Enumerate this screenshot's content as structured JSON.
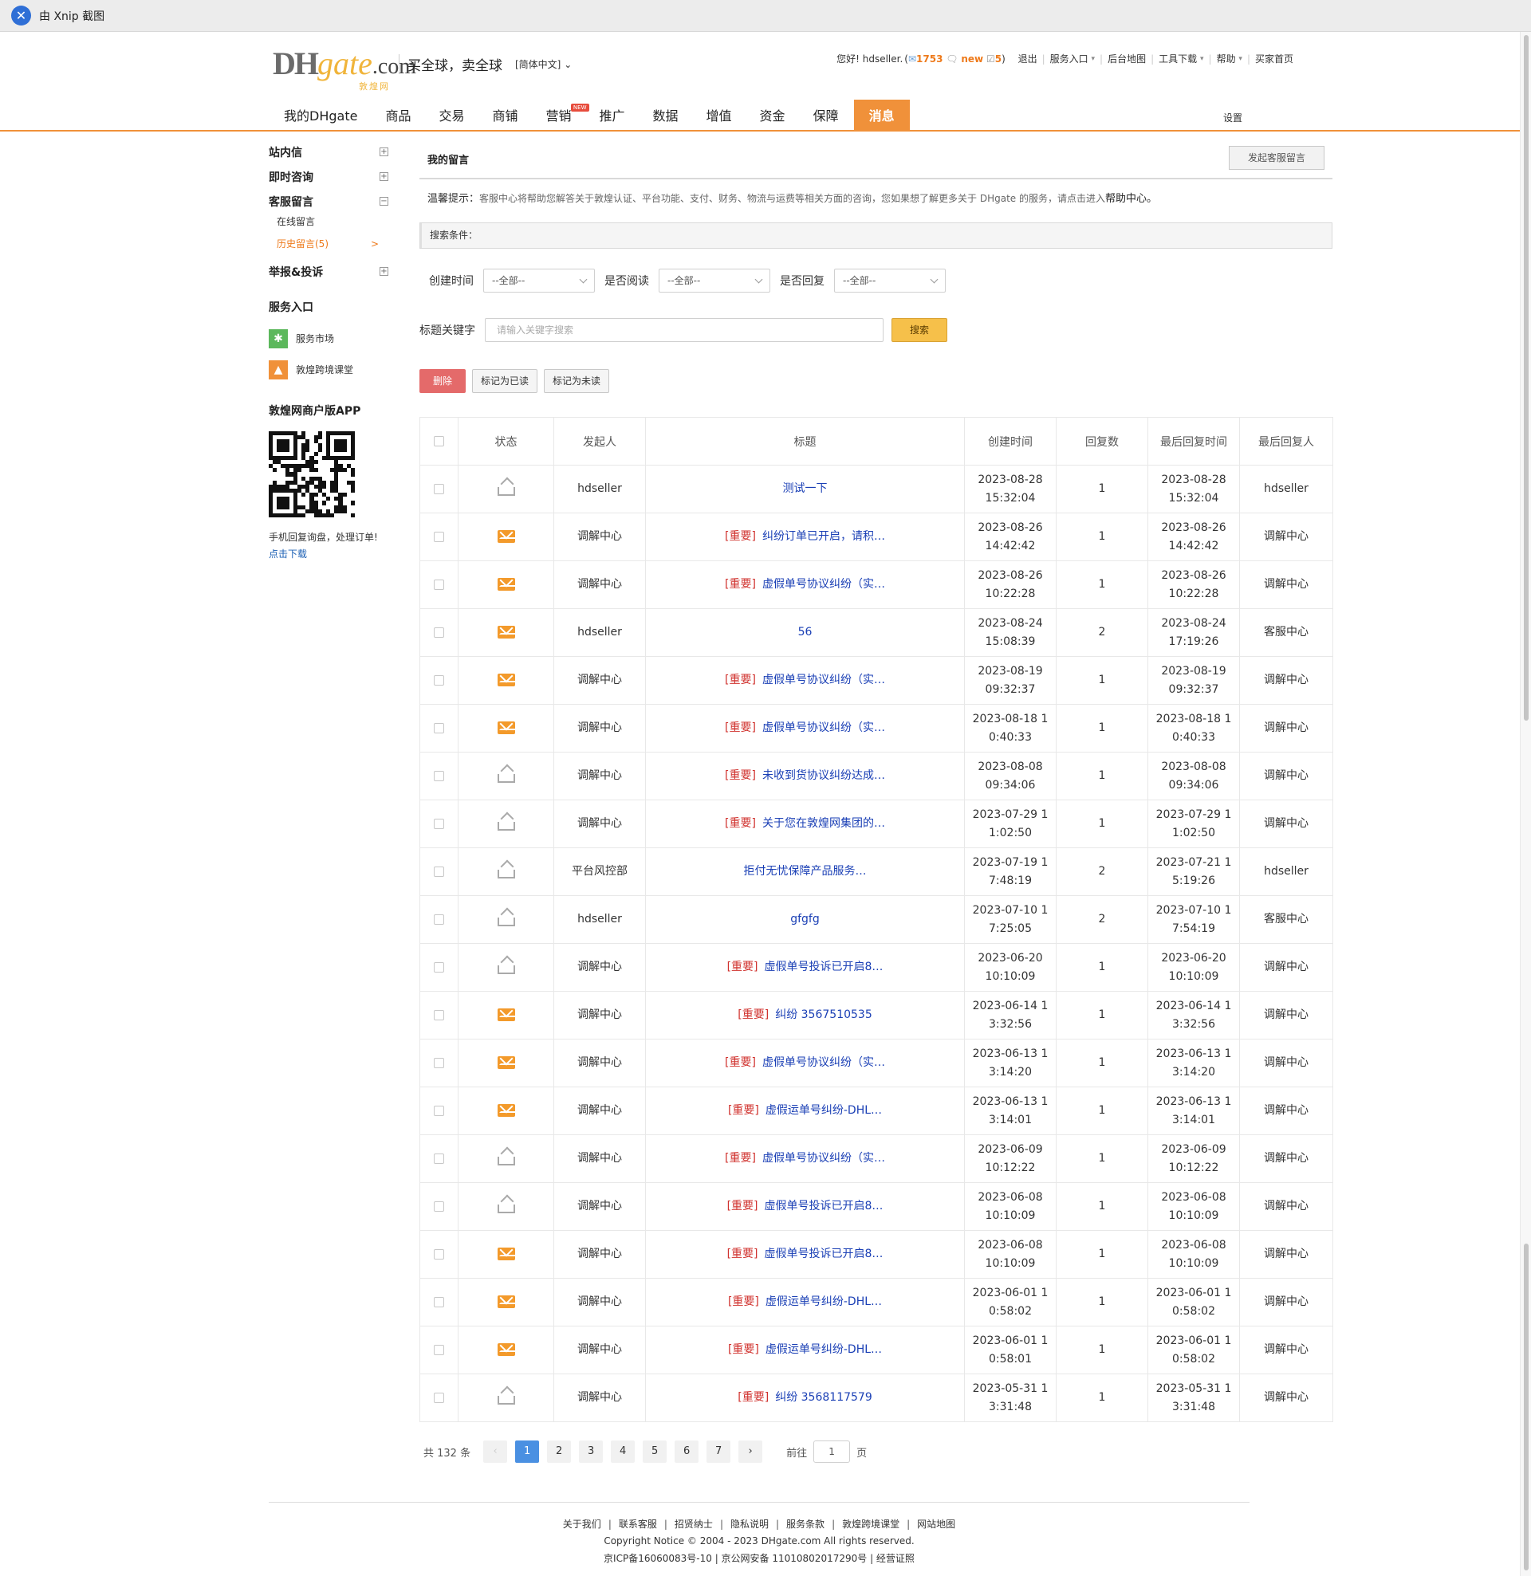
{
  "xnip": {
    "title": "由 Xnip 截图"
  },
  "header": {
    "logo_dh": "DH",
    "logo_gate": "gate",
    "logo_com": ".com",
    "logo_cn": "敦煌网",
    "slogan": "买全球，卖全球",
    "language": "[简体中文]",
    "greeting": "您好!",
    "user": "hdseller.",
    "mail_count": "1753",
    "new_label": "new",
    "msg_count": "5",
    "logout": "退出",
    "service_entry": "服务入口",
    "backend_map": "后台地图",
    "tools_download": "工具下载",
    "help": "帮助",
    "buyer_home": "买家首页"
  },
  "nav": {
    "items": [
      "我的DHgate",
      "商品",
      "交易",
      "商铺",
      "营销",
      "推广",
      "数据",
      "增值",
      "资金",
      "保障",
      "消息"
    ],
    "new_tag": "NEW",
    "settings": "设置"
  },
  "sidebar": {
    "groups": [
      "站内信",
      "即时咨询",
      "客服留言",
      "举报&投诉"
    ],
    "sub_online": "在线留言",
    "sub_history": "历史留言(5)",
    "sub_arrow": ">",
    "service_title": "服务入口",
    "service_market": "服务市场",
    "service_class": "敦煌跨境课堂",
    "app_title": "敦煌网商户版APP",
    "app_desc": "手机回复询盘，处理订单!",
    "app_download": "点击下载"
  },
  "main": {
    "title": "我的留言",
    "new_button": "发起客服留言",
    "tip_label": "温馨提示：",
    "tip_text": "客服中心将帮助您解答关于敦煌认证、平台功能、支付、财务、物流与运费等相关方面的咨询，您如果想了解更多关于 DHgate 的服务，请点击进入",
    "tip_link": "帮助中心。",
    "search_title": "搜索条件：",
    "f_created": "创建时间",
    "f_read": "是否阅读",
    "f_replied": "是否回复",
    "select_all": "--全部--",
    "kw_label": "标题关键字",
    "kw_placeholder": "请输入关键字搜索",
    "search_btn": "搜索",
    "delete_btn": "删除",
    "mark_read_btn": "标记为已读",
    "mark_unread_btn": "标记为未读"
  },
  "table": {
    "headers": [
      "状态",
      "发起人",
      "标题",
      "创建时间",
      "回复数",
      "最后回复时间",
      "最后回复人"
    ],
    "important_tag": "[重要]",
    "rows": [
      {
        "status": "read",
        "sender": "hdseller",
        "imp": false,
        "title": "测试一下",
        "created": "2023-08-28 15:32:04",
        "replies": "1",
        "last_time": "2023-08-28 15:32:04",
        "last_by": "hdseller"
      },
      {
        "status": "unread",
        "sender": "调解中心",
        "imp": true,
        "title": "纠纷订单已开启，请积…",
        "created": "2023-08-26 14:42:42",
        "replies": "1",
        "last_time": "2023-08-26 14:42:42",
        "last_by": "调解中心"
      },
      {
        "status": "unread",
        "sender": "调解中心",
        "imp": true,
        "title": "虚假单号协议纠纷（实…",
        "created": "2023-08-26 10:22:28",
        "replies": "1",
        "last_time": "2023-08-26 10:22:28",
        "last_by": "调解中心"
      },
      {
        "status": "unread",
        "sender": "hdseller",
        "imp": false,
        "title": "56",
        "created": "2023-08-24 15:08:39",
        "replies": "2",
        "last_time": "2023-08-24 17:19:26",
        "last_by": "客服中心"
      },
      {
        "status": "unread",
        "sender": "调解中心",
        "imp": true,
        "title": "虚假单号协议纠纷（实…",
        "created": "2023-08-19 09:32:37",
        "replies": "1",
        "last_time": "2023-08-19 09:32:37",
        "last_by": "调解中心"
      },
      {
        "status": "unread",
        "sender": "调解中心",
        "imp": true,
        "title": "虚假单号协议纠纷（实…",
        "created": "2023-08-18 1 0:40:33",
        "replies": "1",
        "last_time": "2023-08-18 1 0:40:33",
        "last_by": "调解中心"
      },
      {
        "status": "read",
        "sender": "调解中心",
        "imp": true,
        "title": "未收到货协议纠纷达成…",
        "created": "2023-08-08 09:34:06",
        "replies": "1",
        "last_time": "2023-08-08 09:34:06",
        "last_by": "调解中心"
      },
      {
        "status": "read",
        "sender": "调解中心",
        "imp": true,
        "title": "关于您在敦煌网集团的…",
        "created": "2023-07-29 1 1:02:50",
        "replies": "1",
        "last_time": "2023-07-29 1 1:02:50",
        "last_by": "调解中心"
      },
      {
        "status": "read",
        "sender": "平台风控部",
        "imp": false,
        "title": "拒付无忧保障产品服务…",
        "created": "2023-07-19 1 7:48:19",
        "replies": "2",
        "last_time": "2023-07-21 1 5:19:26",
        "last_by": "hdseller"
      },
      {
        "status": "read",
        "sender": "hdseller",
        "imp": false,
        "title": "gfgfg",
        "created": "2023-07-10 1 7:25:05",
        "replies": "2",
        "last_time": "2023-07-10 1 7:54:19",
        "last_by": "客服中心"
      },
      {
        "status": "read",
        "sender": "调解中心",
        "imp": true,
        "title": "虚假单号投诉已开启8…",
        "created": "2023-06-20 10:10:09",
        "replies": "1",
        "last_time": "2023-06-20 10:10:09",
        "last_by": "调解中心"
      },
      {
        "status": "unread",
        "sender": "调解中心",
        "imp": true,
        "title": "纠纷 3567510535",
        "created": "2023-06-14 1 3:32:56",
        "replies": "1",
        "last_time": "2023-06-14 1 3:32:56",
        "last_by": "调解中心"
      },
      {
        "status": "unread",
        "sender": "调解中心",
        "imp": true,
        "title": "虚假单号协议纠纷（实…",
        "created": "2023-06-13 1 3:14:20",
        "replies": "1",
        "last_time": "2023-06-13 1 3:14:20",
        "last_by": "调解中心"
      },
      {
        "status": "unread",
        "sender": "调解中心",
        "imp": true,
        "title": "虚假运单号纠纷-DHL…",
        "created": "2023-06-13 1 3:14:01",
        "replies": "1",
        "last_time": "2023-06-13 1 3:14:01",
        "last_by": "调解中心"
      },
      {
        "status": "read",
        "sender": "调解中心",
        "imp": true,
        "title": "虚假单号协议纠纷（实…",
        "created": "2023-06-09 10:12:22",
        "replies": "1",
        "last_time": "2023-06-09 10:12:22",
        "last_by": "调解中心"
      },
      {
        "status": "read",
        "sender": "调解中心",
        "imp": true,
        "title": "虚假单号投诉已开启8…",
        "created": "2023-06-08 10:10:09",
        "replies": "1",
        "last_time": "2023-06-08 10:10:09",
        "last_by": "调解中心"
      },
      {
        "status": "unread",
        "sender": "调解中心",
        "imp": true,
        "title": "虚假单号投诉已开启8…",
        "created": "2023-06-08 10:10:09",
        "replies": "1",
        "last_time": "2023-06-08 10:10:09",
        "last_by": "调解中心"
      },
      {
        "status": "unread",
        "sender": "调解中心",
        "imp": true,
        "title": "虚假运单号纠纷-DHL…",
        "created": "2023-06-01 1 0:58:02",
        "replies": "1",
        "last_time": "2023-06-01 1 0:58:02",
        "last_by": "调解中心"
      },
      {
        "status": "unread",
        "sender": "调解中心",
        "imp": true,
        "title": "虚假运单号纠纷-DHL…",
        "created": "2023-06-01 1 0:58:01",
        "replies": "1",
        "last_time": "2023-06-01 1 0:58:02",
        "last_by": "调解中心"
      },
      {
        "status": "read",
        "sender": "调解中心",
        "imp": true,
        "title": "纠纷 3568117579",
        "created": "2023-05-31 1 3:31:48",
        "replies": "1",
        "last_time": "2023-05-31 1 3:31:48",
        "last_by": "调解中心"
      }
    ]
  },
  "pager": {
    "total": "共 132 条",
    "prev": "‹",
    "pages": [
      "1",
      "2",
      "3",
      "4",
      "5",
      "6",
      "7"
    ],
    "next": "›",
    "goto_label": "前往",
    "goto_value": "1",
    "page_unit": "页"
  },
  "footer": {
    "links": [
      "关于我们",
      "联系客服",
      "招贤纳士",
      "隐私说明",
      "服务条款",
      "敦煌跨境课堂",
      "网站地图"
    ],
    "copyright": "Copyright Notice © 2004 - 2023 DHgate.com All rights reserved.",
    "icp": "京ICP备16060083号-10 | 京公网安备 11010802017290号 | 经营证照"
  }
}
